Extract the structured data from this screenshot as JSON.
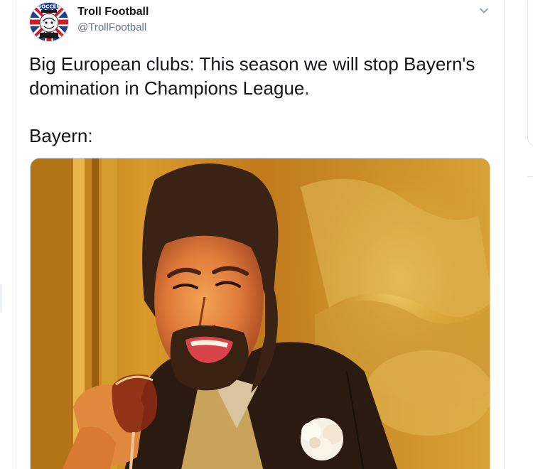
{
  "author": {
    "name": "Troll Football",
    "handle": "@TrollFootball",
    "avatar_text": "SOCCER"
  },
  "header": {
    "menu_icon": "chevron-down-icon"
  },
  "tweet": {
    "lines": [
      "Big European clubs: This season we will stop Bayern's",
      "domination in Champions League."
    ],
    "reply_line": "Bayern:"
  },
  "media": {
    "icon": "meme-photo-laughing-man-with-wine-glass"
  },
  "colors": {
    "text": "#14171a",
    "secondary": "#657786",
    "border": "#e6ecf0",
    "union_jack_blue": "#1f3f8f",
    "union_jack_red": "#d0202e"
  }
}
